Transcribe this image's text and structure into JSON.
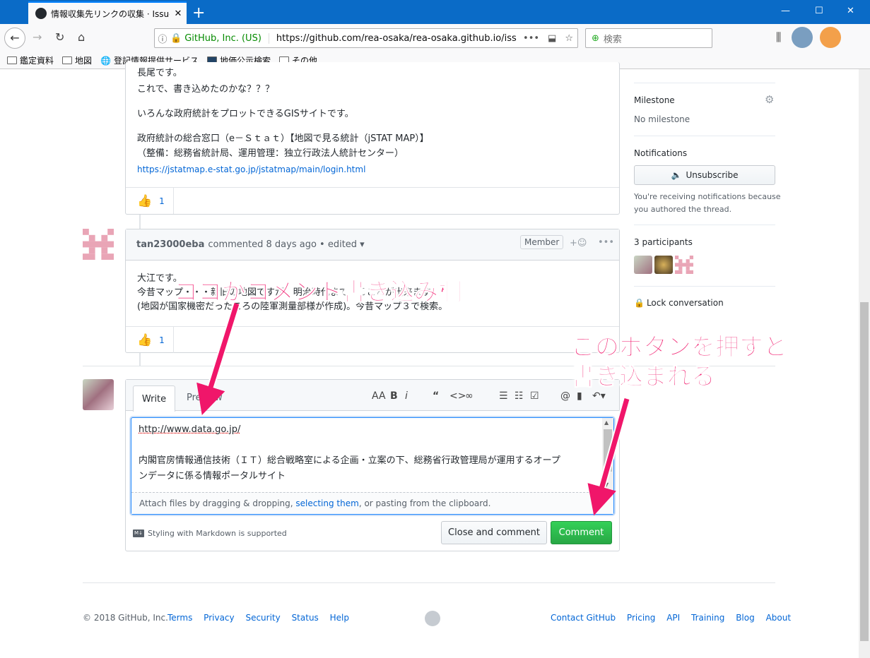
{
  "browser": {
    "tab_title": "情報収集先リンクの収集 · Issue",
    "new_tab": "+",
    "url_org": "GitHub, Inc. (US)",
    "url": "https://github.com/rea-osaka/rea-osaka.github.io/iss",
    "url_more": "•••",
    "search_placeholder": "検索",
    "bookmarks": [
      "鑑定資料",
      "地図",
      "登記情報提供サービス",
      "地価公示検索",
      "その他"
    ]
  },
  "comment1": {
    "lines": [
      "長尾です。",
      "これで、書き込めたのかな？？？",
      "",
      "いろんな政府統計をプロットできるGISサイトです。",
      "",
      "政府統計の総合窓口（e－Ｓｔａｔ）【地図で見る統計（jSTAT MAP）】",
      "（整備：総務省統計局、運用管理：独立行政法人統計センター）"
    ],
    "link": "https://jstatmap.e-stat.go.jp/jstatmap/main/login.html",
    "reaction_count": "1"
  },
  "comment2": {
    "author": "tan23000eba",
    "meta": "commented 8 days ago • edited ▾",
    "badge": "Member",
    "lines": [
      "大江です。",
      "今昔マップ・・・新旧の地図ですが、明治時代まで遡ることが出来ます",
      "(地図が国家機密だったころの陸軍測量部様が作成)。今昔マップ３で検索。"
    ],
    "reaction_count": "1"
  },
  "editor": {
    "tab_write": "Write",
    "tab_preview": "Preview",
    "text_lines": [
      "http://www.data.go.jp/",
      "",
      "内閣官房情報通信技術（ＩＴ）総合戦略室による企画・立案の下、総務省行政管理局が運用するオープ",
      "ンデータに係る情報ポータルサイト"
    ],
    "attach_pre": "Attach files by dragging & dropping, ",
    "attach_link": "selecting them",
    "attach_post": ", or pasting from the clipboard.",
    "markdown_note": "Styling with Markdown is supported",
    "close_comment": "Close and comment",
    "comment": "Comment"
  },
  "sidebar": {
    "milestone_title": "Milestone",
    "milestone_value": "No milestone",
    "notifications_title": "Notifications",
    "unsubscribe": "Unsubscribe",
    "notif_reason_1": "You're receiving notifications because",
    "notif_reason_2": "you authored the thread.",
    "participants": "3 participants",
    "lock": "Lock conversation"
  },
  "annotations": {
    "comment_area": "ココがコメント書き込み欄",
    "button_line1": "このボタンを押すと",
    "button_line2": "書き込まれる"
  },
  "footer": {
    "copyright": "© 2018 GitHub, Inc.",
    "left_links": [
      "Terms",
      "Privacy",
      "Security",
      "Status",
      "Help"
    ],
    "right_links": [
      "Contact GitHub",
      "Pricing",
      "API",
      "Training",
      "Blog",
      "About"
    ]
  },
  "colors": {
    "annotation": "#f0166a",
    "link": "#0366d6",
    "green": "#28a745",
    "chrome": "#0a6bc7"
  }
}
